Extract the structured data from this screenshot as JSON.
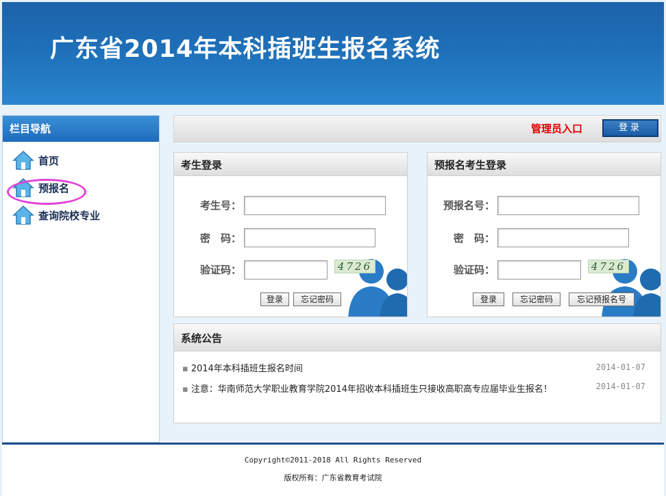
{
  "header": {
    "title": "广东省2014年本科插班生报名系统"
  },
  "sidebar": {
    "title": "栏目导航",
    "items": [
      {
        "label": "首页",
        "icon": "home-icon"
      },
      {
        "label": "预报名",
        "icon": "home-icon"
      },
      {
        "label": "查询院校专业",
        "icon": "home-icon"
      }
    ]
  },
  "admin": {
    "label": "管理员入口",
    "button": "登录"
  },
  "candidate_login": {
    "title": "考生登录",
    "fields": {
      "id_label": "考生号：",
      "password_label": "密　码：",
      "captcha_label": "验证码："
    },
    "captcha_text": "4726",
    "buttons": {
      "login": "登录",
      "forgot_password": "忘记密码"
    }
  },
  "prereg_login": {
    "title": "预报名考生登录",
    "fields": {
      "id_label": "预报名号：",
      "password_label": "密　码：",
      "captcha_label": "验证码："
    },
    "captcha_text": "4726",
    "buttons": {
      "login": "登录",
      "forgot_password": "忘记密码",
      "forgot_number": "忘记预报名号"
    }
  },
  "notices": {
    "title": "系统公告",
    "items": [
      {
        "text": "2014年本科插班生报名时间",
        "date": "2014-01-07"
      },
      {
        "text": "注意：华南师范大学职业教育学院2014年招收本科插班生只接收高职高专应届毕业生报名！",
        "date": "2014-01-07"
      }
    ]
  },
  "footer": {
    "copyright": "Copyright©2011-2018 All Rights Reserved",
    "owner": "版权所有：广东省教育考试院"
  },
  "colors": {
    "banner": "#1e6fb8",
    "admin_label": "#e00000",
    "annotation": "#e040d8"
  }
}
